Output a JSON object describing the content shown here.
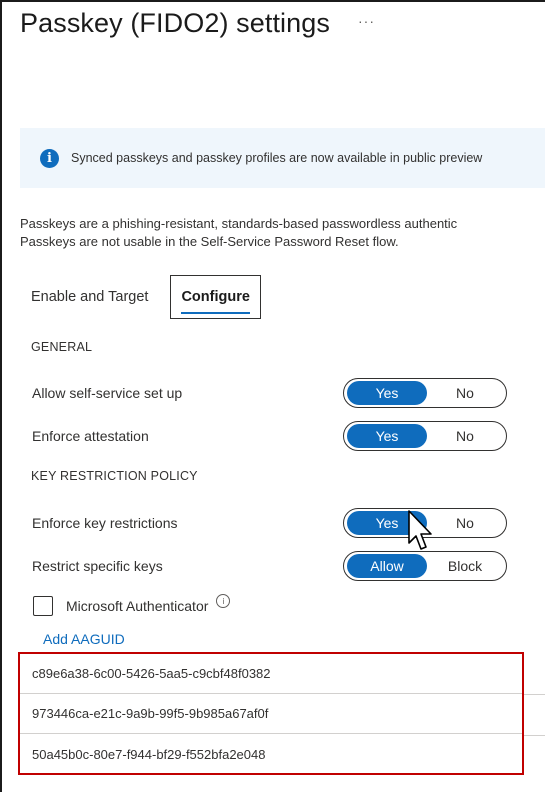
{
  "header": {
    "title": "Passkey (FIDO2) settings",
    "more": "···"
  },
  "banner": {
    "icon": "info-icon",
    "text": "Synced passkeys and passkey profiles are now available in public preview"
  },
  "description": {
    "line1": "Passkeys are a phishing-resistant, standards-based passwordless authentic",
    "line2": "Passkeys are not usable in the Self-Service Password Reset flow."
  },
  "tabs": [
    {
      "label": "Enable and Target",
      "active": false
    },
    {
      "label": "Configure",
      "active": true
    }
  ],
  "general": {
    "section_label": "GENERAL",
    "self_service": {
      "label": "Allow self-service set up",
      "left": "Yes",
      "right": "No",
      "selected": "Yes"
    },
    "attestation": {
      "label": "Enforce attestation",
      "left": "Yes",
      "right": "No",
      "selected": "Yes"
    }
  },
  "key_restriction": {
    "section_label": "KEY RESTRICTION POLICY",
    "enforce": {
      "label": "Enforce key restrictions",
      "left": "Yes",
      "right": "No",
      "selected": "Yes"
    },
    "restrict": {
      "label": "Restrict specific keys",
      "left": "Allow",
      "right": "Block",
      "selected": "Allow"
    }
  },
  "authenticator": {
    "label": "Microsoft Authenticator",
    "checked": false,
    "info_glyph": "i"
  },
  "add_aaguid": "Add AAGUID",
  "aaguids": [
    "c89e6a38-6c00-5426-5aa5-c9cbf48f0382",
    "973446ca-e21c-9a9b-99f5-9b985a67af0f",
    "50a45b0c-80e7-f944-bf29-f552bfa2e048"
  ],
  "colors": {
    "accent": "#0f6cbd",
    "highlight_border": "#c00000",
    "banner_bg": "#eff6fc"
  }
}
